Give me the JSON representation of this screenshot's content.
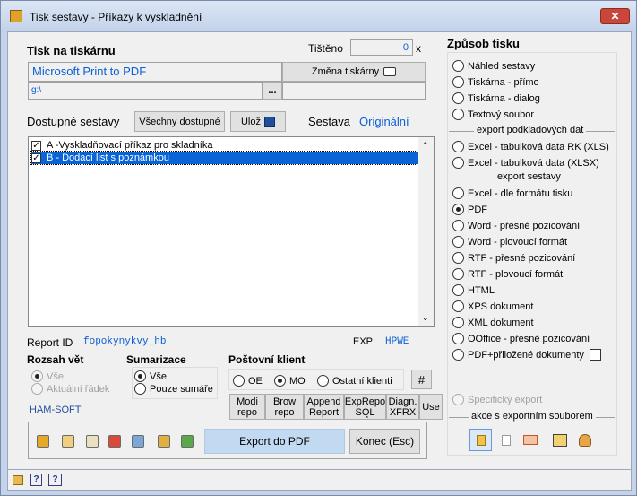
{
  "window": {
    "title": "Tisk sestavy -  Příkazy k vyskladnění",
    "close_glyph": "✕"
  },
  "print": {
    "header": "Tisk na tiskárnu",
    "printed_label": "Tištěno",
    "printed_value": "0",
    "printed_suffix": "x",
    "printer_name": "Microsoft Print to PDF",
    "change_printer": "Změna  tiskárny",
    "path": "g:\\",
    "browse": "..."
  },
  "reports": {
    "label": "Dostupné sestavy",
    "all_available": "Všechny dostupné",
    "save": "Ulož",
    "sestava_label": "Sestava",
    "sestava_value": "Originální",
    "items": [
      {
        "label": "A -Vyskladňovací příkaz pro skladníka",
        "checked": "✓"
      },
      {
        "label": "B - Dodací list s poznámkou",
        "checked": "✓"
      }
    ]
  },
  "report_id": {
    "label": "Report ID",
    "value": "fopokynykvy_hb",
    "exp_label": "EXP:",
    "exp_value": "HPWE"
  },
  "range": {
    "header": "Rozsah vět",
    "all": "Vše",
    "current": "Aktuální řádek"
  },
  "summary": {
    "header": "Sumarizace",
    "all": "Vše",
    "only": "Pouze sumáře"
  },
  "brand": "HAM-SOFT",
  "mail": {
    "header": "Poštovní klient",
    "oe": "OE",
    "mo": "MO",
    "other": "Ostatní klienti",
    "hash": "#"
  },
  "repo": {
    "modi": [
      "Modi",
      "repo"
    ],
    "brow": [
      "Brow",
      "repo"
    ],
    "append": [
      "Append",
      "Report"
    ],
    "exprepo": [
      "ExpRepo",
      "SQL"
    ],
    "diagn": [
      "Diagn.",
      "XFRX"
    ],
    "use": "Use"
  },
  "actions": {
    "export": "Export do PDF",
    "exit": "Konec (Esc)"
  },
  "mode": {
    "header": "Způsob tisku",
    "preview": "Náhled sestavy",
    "direct": "Tiskárna - přímo",
    "dialog": "Tiskárna - dialog",
    "text": "Textový soubor",
    "sec_data": "export podkladových dat",
    "xls_rk": "Excel - tabulková data RK (XLS)",
    "xlsx": "Excel - tabulková data (XLSX)",
    "sec_report": "export sestavy",
    "xls_fmt": "Excel - dle formátu tisku",
    "pdf": "PDF",
    "word_exact": "Word - přesné pozicování",
    "word_float": "Word - plovoucí formát",
    "rtf_exact": "RTF - přesné pozicování",
    "rtf_float": "RTF - plovoucí formát",
    "html": "HTML",
    "xps": "XPS dokument",
    "xml": "XML dokument",
    "ooffice": "OOffice - přesné pozicování",
    "pdf_attach": "PDF+přiložené dokumenty",
    "specific": "Specifický export",
    "sec_actions": "akce s exportním souborem"
  },
  "colors": {
    "accent": "#0b5fd6",
    "selection": "#0a64d6",
    "close": "#c8463a"
  }
}
